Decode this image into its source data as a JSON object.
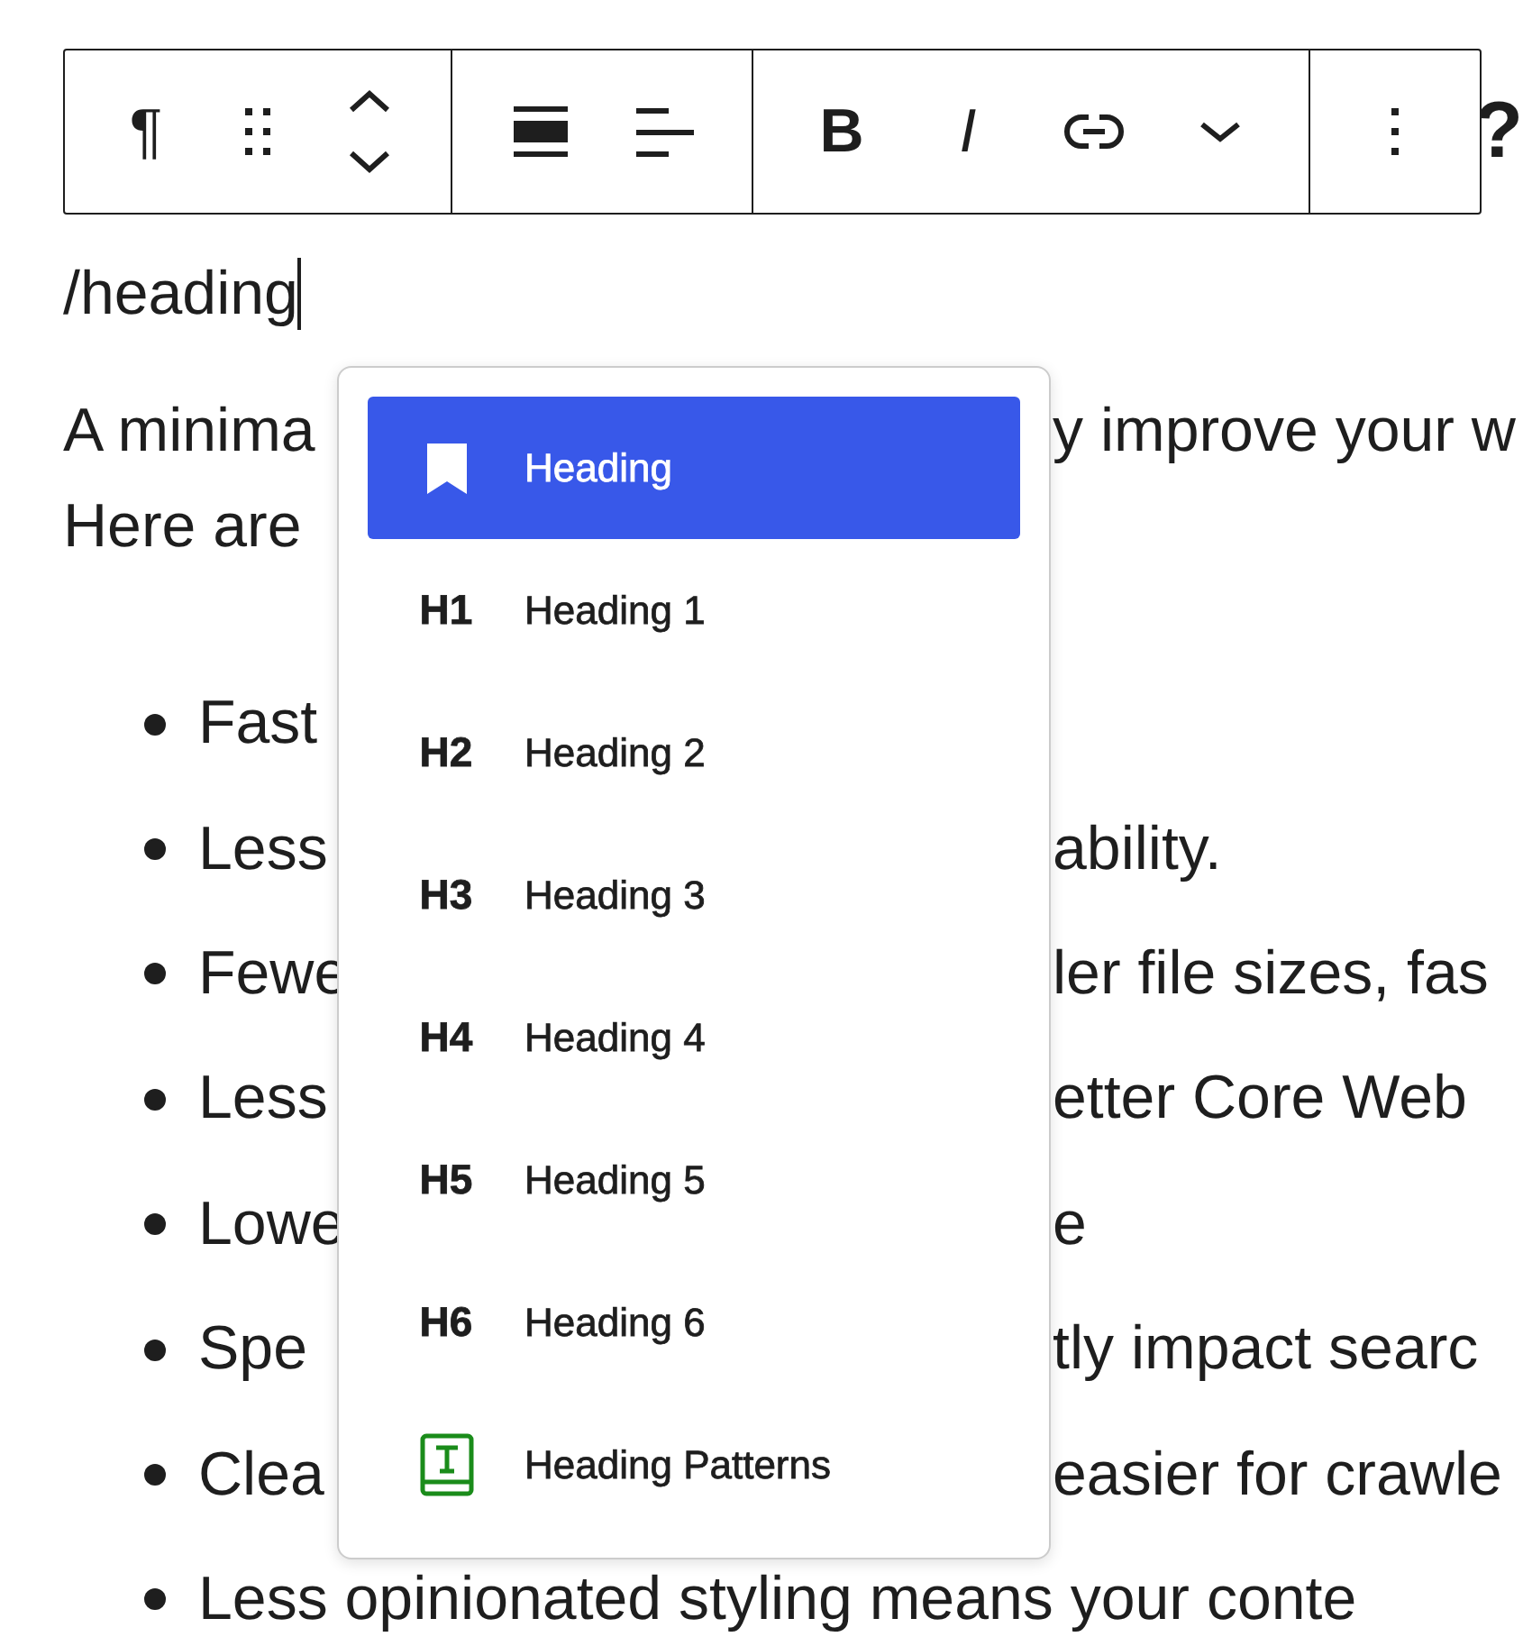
{
  "toolbar": {
    "groups": [
      {
        "items": [
          {
            "kind": "glyph",
            "text": "¶"
          },
          {
            "kind": "drag"
          },
          {
            "kind": "updown"
          }
        ]
      },
      {
        "items": [
          {
            "kind": "align-wide"
          },
          {
            "kind": "align-left"
          }
        ]
      },
      {
        "items": [
          {
            "kind": "glyph",
            "text": "B"
          },
          {
            "kind": "italic",
            "text": "I"
          },
          {
            "kind": "link"
          },
          {
            "kind": "chevron"
          }
        ]
      },
      {
        "items": [
          {
            "kind": "more"
          }
        ]
      }
    ]
  },
  "heading_fragment": "?",
  "editor_line": "/heading",
  "paragraph_lines": [
    {
      "left": "A minima",
      "right": "y improve your w"
    },
    {
      "left": "Here are"
    }
  ],
  "bullets": [
    {
      "left": "Fast"
    },
    {
      "left": "Less",
      "right": "ability."
    },
    {
      "left": "Fewe",
      "right": "ler file sizes, fas"
    },
    {
      "left": "Less",
      "right": "etter Core Web"
    },
    {
      "left": "Lowe",
      "right": "e"
    },
    {
      "left": "Spe",
      "right": "tly impact searc"
    },
    {
      "left": "Clea",
      "right": "easier for crawle"
    },
    {
      "text": "Less opinionated styling means your conte"
    }
  ],
  "menu": [
    {
      "kind": "bookmark",
      "label": "Heading",
      "selected": true
    },
    {
      "kind": "text",
      "icon_text": "H1",
      "label": "Heading 1",
      "selected": false
    },
    {
      "kind": "text",
      "icon_text": "H2",
      "label": "Heading 2",
      "selected": false
    },
    {
      "kind": "text",
      "icon_text": "H3",
      "label": "Heading 3",
      "selected": false
    },
    {
      "kind": "text",
      "icon_text": "H4",
      "label": "Heading 4",
      "selected": false
    },
    {
      "kind": "text",
      "icon_text": "H5",
      "label": "Heading 5",
      "selected": false
    },
    {
      "kind": "text",
      "icon_text": "H6",
      "label": "Heading 6",
      "selected": false
    },
    {
      "kind": "pattern",
      "label": "Heading Patterns",
      "selected": false
    }
  ]
}
